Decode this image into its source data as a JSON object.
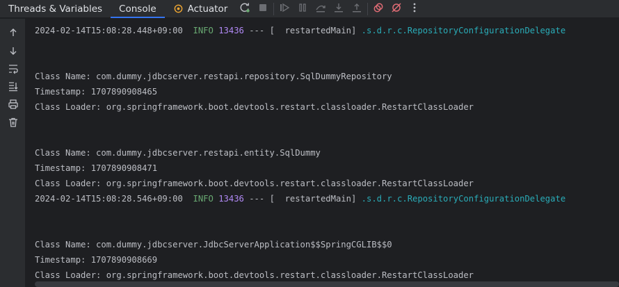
{
  "tabs": {
    "threads_label": "Threads & Variables",
    "console_label": "Console",
    "actuator_label": "Actuator"
  },
  "toolbar_icons": [
    "rerun-icon",
    "stop-icon",
    "resume-icon",
    "pause-icon",
    "step-over-icon",
    "step-into-icon",
    "step-out-icon",
    "view-breakpoints-icon",
    "mute-breakpoints-icon",
    "more-icon"
  ],
  "gutter_icons": [
    "scroll-up-icon",
    "scroll-down-icon",
    "soft-wrap-icon",
    "scroll-to-end-icon",
    "print-icon",
    "clear-icon"
  ],
  "log_entries": [
    {
      "timestamp": "2024-02-14T15:08:28.448+09:00",
      "level": "INFO",
      "pid": "13436",
      "sep": "--- [",
      "thread": "  restartedMain]",
      "logger": ".s.d.r.c.RepositoryConfigurationDelegate"
    },
    {
      "timestamp": "2024-02-14T15:08:28.546+09:00",
      "level": "INFO",
      "pid": "13436",
      "sep": "--- [",
      "thread": "  restartedMain]",
      "logger": ".s.d.r.c.RepositoryConfigurationDelegate"
    }
  ],
  "blocks": [
    {
      "class_name": "Class Name: com.dummy.jdbcserver.restapi.repository.SqlDummyRepository",
      "timestamp": "Timestamp: 1707890908465",
      "loader": "Class Loader: org.springframework.boot.devtools.restart.classloader.RestartClassLoader"
    },
    {
      "class_name": "Class Name: com.dummy.jdbcserver.restapi.entity.SqlDummy",
      "timestamp": "Timestamp: 1707890908471",
      "loader": "Class Loader: org.springframework.boot.devtools.restart.classloader.RestartClassLoader"
    },
    {
      "class_name": "Class Name: com.dummy.jdbcserver.JdbcServerApplication$$SpringCGLIB$$0",
      "timestamp": "Timestamp: 1707890908669",
      "loader": "Class Loader: org.springframework.boot.devtools.restart.classloader.RestartClassLoader"
    }
  ],
  "colors": {
    "accent": "#3574f0",
    "info": "#6aab73",
    "pid": "#b189f5",
    "logger": "#2aacb8",
    "rerun": "#f0a732",
    "mute": "#e06c75"
  }
}
